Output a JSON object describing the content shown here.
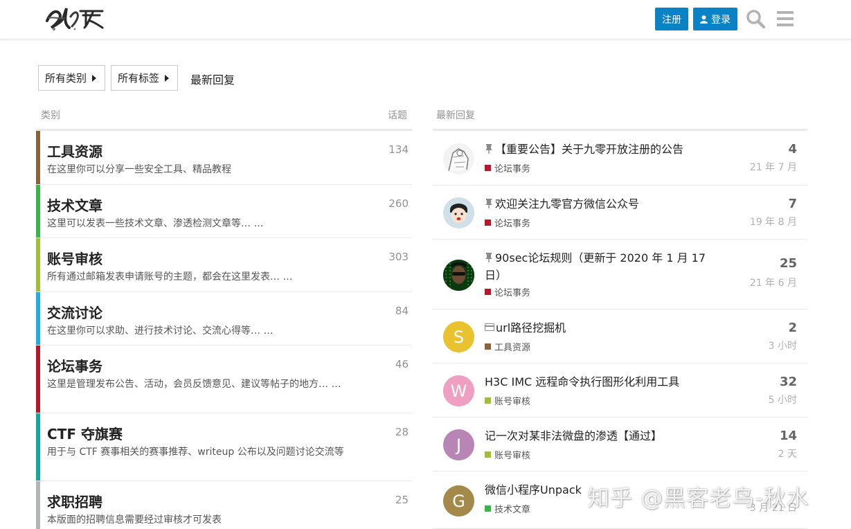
{
  "header": {
    "signup_label": "注册",
    "login_label": "登录",
    "accent": "#0a82c6"
  },
  "nav": {
    "categories_label": "所有类别",
    "tags_label": "所有标签",
    "latest_label": "最新回复"
  },
  "categories_header": {
    "name": "类别",
    "count": "话题"
  },
  "latest_header": "最新回复",
  "categories": [
    {
      "name": "工具资源",
      "desc": "在这里你可以分享一些安全工具、精品教程",
      "count": "134",
      "color": "#8c6238"
    },
    {
      "name": "技术文章",
      "desc": "这里可以发表一些技术文章、渗透检测文章等… …",
      "count": "260",
      "color": "#3ab54a"
    },
    {
      "name": "账号审核",
      "desc": "所有通过邮箱发表申请账号的主题，都会在这里发表… …",
      "count": "303",
      "color": "#a1be3a"
    },
    {
      "name": "交流讨论",
      "desc": "在这里你可以求助、进行技术讨论、交流心得等… …",
      "count": "84",
      "color": "#25aae1"
    },
    {
      "name": "论坛事务",
      "desc": "这里是管理发布公告、活动，会员反馈意见、建议等帖子的地方… …",
      "count": "46",
      "color": "#b5182b"
    },
    {
      "name": "CTF 夺旗赛",
      "desc": "用于与 CTF 赛事相关的赛事推荐、writeup 公布以及问题讨论交流等",
      "count": "28",
      "color": "#12a89d"
    },
    {
      "name": "求职招聘",
      "desc": "本版面的招聘信息需要经过审核才可发表",
      "count": "25",
      "color": "#b3b5b4"
    }
  ],
  "topics": [
    {
      "title": "【重要公告】关于九零开放注册的公告",
      "pinned": true,
      "category": "论坛事务",
      "cat_color": "#b5182b",
      "replies": "4",
      "age": "21 年 7 月",
      "avatar_type": "sketch"
    },
    {
      "title": "欢迎关注九零官方微信公众号",
      "pinned": true,
      "category": "论坛事务",
      "cat_color": "#b5182b",
      "replies": "7",
      "age": "19 年 8 月",
      "avatar_type": "cartoon"
    },
    {
      "title": "90sec论坛规则（更新于 2020 年 1 月 17 日）",
      "pinned": true,
      "category": "论坛事务",
      "cat_color": "#b5182b",
      "replies": "25",
      "age": "21 年 6 月",
      "avatar_type": "matrix"
    },
    {
      "title": "url路径挖掘机",
      "archived": true,
      "category": "工具资源",
      "cat_color": "#8c6238",
      "replies": "2",
      "age": "3 小时",
      "avatar_letter": "S",
      "avatar_color": "#e8c22f"
    },
    {
      "title": "H3C IMC 远程命令执行图形化利用工具",
      "category": "账号审核",
      "cat_color": "#a1be3a",
      "replies": "32",
      "age": "5 小时",
      "avatar_letter": "W",
      "avatar_color": "#ef9fc2"
    },
    {
      "title": "记一次对某非法微盘的渗透【通过】",
      "category": "账号审核",
      "cat_color": "#a1be3a",
      "replies": "14",
      "age": "2 天",
      "avatar_letter": "J",
      "avatar_color": "#b886b4"
    },
    {
      "title": "微信小程序Unpack",
      "category": "技术文章",
      "cat_color": "#3ab54a",
      "replies": "",
      "age": "3 月 21 日",
      "avatar_letter": "G",
      "avatar_color": "#a48a4a"
    }
  ],
  "watermark": "知乎 @黑客老鸟-秋水"
}
